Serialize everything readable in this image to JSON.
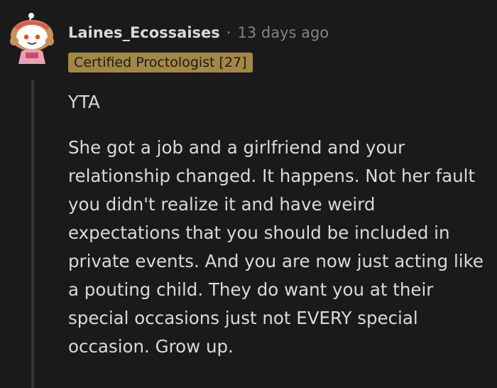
{
  "comment": {
    "author": "Laines_Ecossaises",
    "separator": "·",
    "timestamp": "13 days ago",
    "flair": "Certified Proctologist [27]",
    "verdict": "YTA",
    "body": "She got a job and a girlfriend and your relationship changed. It happens. Not her fault you didn't realize it and have weird expectations that you should be included in private events. And you are now just acting like a pouting child. They do want you at their special occasions just not EVERY special occasion. Grow up."
  },
  "colors": {
    "background": "#1a1a1b",
    "text": "#d7dadc",
    "muted": "#818384",
    "flair_bg": "#a38845",
    "thread_line": "#343536"
  },
  "icons": {
    "avatar": "snoo-avatar-icon"
  }
}
